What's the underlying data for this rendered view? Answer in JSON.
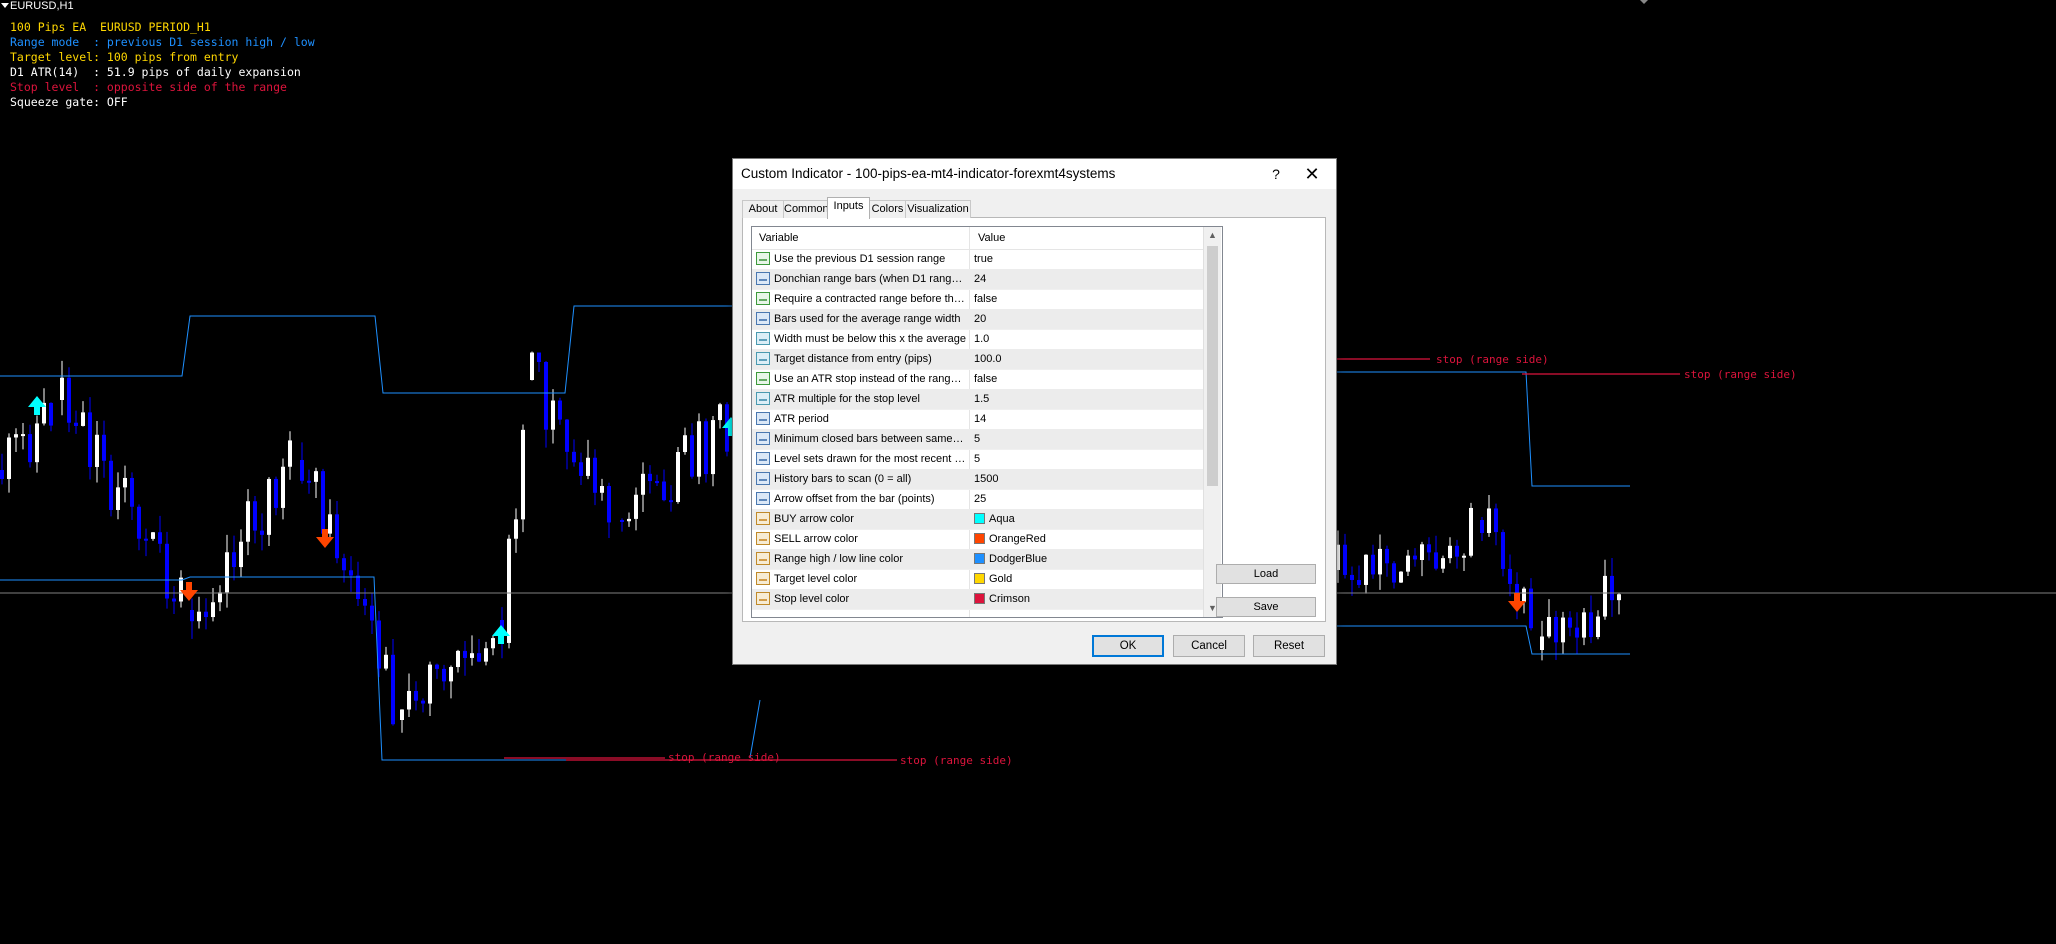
{
  "chart": {
    "symbol": "EURUSD,H1",
    "overlay": [
      {
        "text": "100 Pips EA  EURUSD PERIOD_H1",
        "color": "#ffd700"
      },
      {
        "text": "Range mode  : previous D1 session high / low",
        "color": "#1e90ff"
      },
      {
        "text": "Target level: 100 pips from entry",
        "color": "#ffd700"
      },
      {
        "text": "D1 ATR(14)  : 51.9 pips of daily expansion",
        "color": "#ffffff"
      },
      {
        "text": "Stop level  : opposite side of the range",
        "color": "#dc143c"
      },
      {
        "text": "Squeeze gate: OFF",
        "color": "#ffffff"
      }
    ],
    "stop_labels": [
      "stop (range side)",
      "stop (range side)",
      "stop (range side)",
      "stop (range side)"
    ],
    "colors": {
      "background": "#000000",
      "bull_candle": "#ffffff",
      "bear_candle": "#0000ff",
      "range_line": "#1e90ff",
      "stop_line": "#dc143c",
      "buy_arrow": "#00ffff",
      "sell_arrow": "#ff4500"
    }
  },
  "dialog": {
    "title": "Custom Indicator - 100-pips-ea-mt4-indicator-forexmt4systems",
    "help": "?",
    "close": "✕",
    "tabs": [
      {
        "label": "About",
        "active": false
      },
      {
        "label": "Common",
        "active": false
      },
      {
        "label": "Inputs",
        "active": true
      },
      {
        "label": "Colors",
        "active": false
      },
      {
        "label": "Visualization",
        "active": false
      }
    ],
    "grid": {
      "columns": [
        "Variable",
        "Value"
      ],
      "rows": [
        {
          "icon": "bool",
          "name": "Use the previous D1 session range",
          "value": "true"
        },
        {
          "icon": "int",
          "name": "Donchian range bars (when D1 range i...",
          "value": "24"
        },
        {
          "icon": "bool",
          "name": "Require a contracted range before the ...",
          "value": "false"
        },
        {
          "icon": "int",
          "name": "Bars used for the average range width",
          "value": "20"
        },
        {
          "icon": "dbl",
          "name": "Width must be below this x the average",
          "value": "1.0"
        },
        {
          "icon": "dbl",
          "name": "Target distance from entry (pips)",
          "value": "100.0"
        },
        {
          "icon": "bool",
          "name": "Use an ATR stop instead of the range ...",
          "value": "false"
        },
        {
          "icon": "dbl",
          "name": "ATR multiple for the stop level",
          "value": "1.5"
        },
        {
          "icon": "int",
          "name": "ATR period",
          "value": "14"
        },
        {
          "icon": "int",
          "name": "Minimum closed bars between same-si...",
          "value": "5"
        },
        {
          "icon": "int",
          "name": "Level sets drawn for the most recent si...",
          "value": "5"
        },
        {
          "icon": "int",
          "name": "History bars to scan (0 = all)",
          "value": "1500"
        },
        {
          "icon": "int",
          "name": "Arrow offset from the bar (points)",
          "value": "25"
        },
        {
          "icon": "clr",
          "name": "BUY arrow color",
          "value": "Aqua",
          "swatch": "#00ffff"
        },
        {
          "icon": "clr",
          "name": "SELL arrow color",
          "value": "OrangeRed",
          "swatch": "#ff4500"
        },
        {
          "icon": "clr",
          "name": "Range high / low line color",
          "value": "DodgerBlue",
          "swatch": "#1e90ff"
        },
        {
          "icon": "clr",
          "name": "Target level color",
          "value": "Gold",
          "swatch": "#ffd700"
        },
        {
          "icon": "clr",
          "name": "Stop level color",
          "value": "Crimson",
          "swatch": "#dc143c"
        }
      ]
    },
    "buttons": {
      "load": "Load",
      "save": "Save",
      "ok": "OK",
      "cancel": "Cancel",
      "reset": "Reset"
    }
  }
}
